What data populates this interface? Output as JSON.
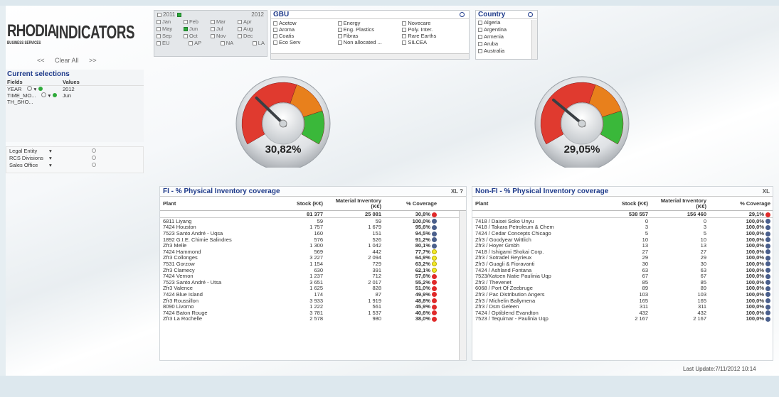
{
  "branding": {
    "company": "RHODIA",
    "subtitle": "BUSINESS SERVICES",
    "title": "INDICATORS"
  },
  "nav": {
    "prev": "<<",
    "clear_all": "Clear All",
    "next": ">>"
  },
  "current_selections": {
    "title": "Current selections",
    "col_fields": "Fields",
    "col_values": "Values",
    "rows": [
      {
        "field": "YEAR",
        "value": "2012"
      },
      {
        "field": "TIME_MO...",
        "value": "Jun"
      },
      {
        "field": "TH_SHO...",
        "value": ""
      }
    ]
  },
  "filters": [
    {
      "label": "Legal Entity"
    },
    {
      "label": "RCS Divisions"
    },
    {
      "label": "Sales Office"
    }
  ],
  "calendar": {
    "year_prev": "2011",
    "year_curr": "2012",
    "months": [
      "Jan",
      "Feb",
      "Mar",
      "Apr",
      "May",
      "Jun",
      "Jul",
      "Aug",
      "Sep",
      "Oct",
      "Nov",
      "Dec"
    ],
    "selected_month": "Jun",
    "regions": [
      "EU",
      "AP",
      "NA",
      "LA"
    ]
  },
  "gbu": {
    "title": "GBU",
    "items": [
      "Acetow",
      "Energy",
      "Novecare",
      "Aroma",
      "Eng. Plastics",
      "Poly. Inter.",
      "Coatis",
      "Fibras",
      "Rare Earths",
      "Eco Serv",
      "Non allocated ...",
      "SILCEA"
    ]
  },
  "country": {
    "title": "Country",
    "items": [
      "Algeria",
      "Argentina",
      "Armenia",
      "Aruba",
      "Australia"
    ]
  },
  "gauges": {
    "left": {
      "value": "30,82%",
      "needle_pct": 30.82
    },
    "right": {
      "value": "29,05%",
      "needle_pct": 29.05
    },
    "colors": {
      "red": "#e03a2f",
      "orange": "#e8801c",
      "green": "#3ab83a"
    }
  },
  "fi_table": {
    "title": "FI - % Physical Inventory coverage",
    "tools": "XL ?",
    "col_plant": "Plant",
    "col_stock": "Stock (K€)",
    "col_material": "Material Inventory (K€)",
    "col_cov": "% Coverage",
    "totals": {
      "stock": "81 377",
      "material": "25 081",
      "cov": "30,8%",
      "status": "red"
    },
    "rows": [
      {
        "plant": "6811 Liyang",
        "stock": "59",
        "material": "59",
        "cov": "100,0%",
        "status": "blue"
      },
      {
        "plant": "7424 Houston",
        "stock": "1 757",
        "material": "1 679",
        "cov": "95,6%",
        "status": "blue"
      },
      {
        "plant": "7523 Santo André - Uqsa",
        "stock": "160",
        "material": "151",
        "cov": "94,5%",
        "status": "blue"
      },
      {
        "plant": "1892 G.I.E. Chimie Salindres",
        "stock": "576",
        "material": "526",
        "cov": "91,2%",
        "status": "blue"
      },
      {
        "plant": "Zfr3 Melle",
        "stock": "1 300",
        "material": "1 042",
        "cov": "80,1%",
        "status": "blue"
      },
      {
        "plant": "7424 Hammond",
        "stock": "569",
        "material": "442",
        "cov": "77,7%",
        "status": "yellow"
      },
      {
        "plant": "Zfr3 Collonges",
        "stock": "3 227",
        "material": "2 094",
        "cov": "64,9%",
        "status": "yellow"
      },
      {
        "plant": "7531 Gorzow",
        "stock": "1 154",
        "material": "729",
        "cov": "63,2%",
        "status": "yellow"
      },
      {
        "plant": "Zfr3 Clamecy",
        "stock": "630",
        "material": "391",
        "cov": "62,1%",
        "status": "yellow"
      },
      {
        "plant": "7424 Vernon",
        "stock": "1 237",
        "material": "712",
        "cov": "57,6%",
        "status": "red"
      },
      {
        "plant": "7523 Santo André - Utsa",
        "stock": "3 651",
        "material": "2 017",
        "cov": "55,2%",
        "status": "red"
      },
      {
        "plant": "Zfr3 Valence",
        "stock": "1 625",
        "material": "828",
        "cov": "51,0%",
        "status": "red"
      },
      {
        "plant": "7424 Blue Island",
        "stock": "174",
        "material": "87",
        "cov": "49,9%",
        "status": "red"
      },
      {
        "plant": "Zfr3 Roussillon",
        "stock": "3 933",
        "material": "1 919",
        "cov": "48,8%",
        "status": "red"
      },
      {
        "plant": "8090 Livorno",
        "stock": "1 222",
        "material": "561",
        "cov": "45,9%",
        "status": "red"
      },
      {
        "plant": "7424 Baton Rouge",
        "stock": "3 781",
        "material": "1 537",
        "cov": "40,6%",
        "status": "red"
      },
      {
        "plant": "Zfr3 La Rochelle",
        "stock": "2 578",
        "material": "980",
        "cov": "38,0%",
        "status": "red"
      }
    ]
  },
  "nonfi_table": {
    "title": "Non-FI - % Physical Inventory coverage",
    "tools": "XL",
    "col_plant": "Plant",
    "col_stock": "Stock (K€)",
    "col_material": "Material Inventory (K€)",
    "col_cov": "% Coverage",
    "totals": {
      "stock": "538 557",
      "material": "156 460",
      "cov": "29,1%",
      "status": "red"
    },
    "rows": [
      {
        "plant": "7418 / Daisei Soko Unyu",
        "stock": "0",
        "material": "0",
        "cov": "100,0%",
        "status": "blue"
      },
      {
        "plant": "7418 / Takara Petroleum & Chem",
        "stock": "3",
        "material": "3",
        "cov": "100,0%",
        "status": "blue"
      },
      {
        "plant": "7424 / Cedar Concepts Chicago",
        "stock": "5",
        "material": "5",
        "cov": "100,0%",
        "status": "blue"
      },
      {
        "plant": "Zfr3 / Goodyear Wittlich",
        "stock": "10",
        "material": "10",
        "cov": "100,0%",
        "status": "blue"
      },
      {
        "plant": "Zfr3 / Hoyer Gmbh",
        "stock": "13",
        "material": "13",
        "cov": "100,0%",
        "status": "blue"
      },
      {
        "plant": "7418 / Ishigami Shokai Corp.",
        "stock": "27",
        "material": "27",
        "cov": "100,0%",
        "status": "blue"
      },
      {
        "plant": "Zfr3 / Sotradel Reyrieux",
        "stock": "29",
        "material": "29",
        "cov": "100,0%",
        "status": "blue"
      },
      {
        "plant": "Zfr3 / Guagli & Fioravanti",
        "stock": "30",
        "material": "30",
        "cov": "100,0%",
        "status": "blue"
      },
      {
        "plant": "7424 / Ashland Fontana",
        "stock": "63",
        "material": "63",
        "cov": "100,0%",
        "status": "blue"
      },
      {
        "plant": "7523/Katoen Natie Paulinia Uqp",
        "stock": "67",
        "material": "67",
        "cov": "100,0%",
        "status": "blue"
      },
      {
        "plant": "Zfr3 / Thevenet",
        "stock": "85",
        "material": "85",
        "cov": "100,0%",
        "status": "blue"
      },
      {
        "plant": "6068 / Port Of Zeebruge",
        "stock": "89",
        "material": "89",
        "cov": "100,0%",
        "status": "blue"
      },
      {
        "plant": "Zfr3 / Pac Distribution Angers",
        "stock": "103",
        "material": "103",
        "cov": "100,0%",
        "status": "blue"
      },
      {
        "plant": "Zfr3 / Michelin Ballymena",
        "stock": "165",
        "material": "165",
        "cov": "100,0%",
        "status": "blue"
      },
      {
        "plant": "Zfr3 / Dsm Geleen",
        "stock": "311",
        "material": "311",
        "cov": "100,0%",
        "status": "blue"
      },
      {
        "plant": "7424 / Optiblend Evandton",
        "stock": "432",
        "material": "432",
        "cov": "100,0%",
        "status": "blue"
      },
      {
        "plant": "7523 / Tequimar - Paulinia Uqp",
        "stock": "2 167",
        "material": "2 167",
        "cov": "100,0%",
        "status": "blue"
      }
    ]
  },
  "status_colors": {
    "blue": "#4a5f8c",
    "yellow": "#f2ea2a",
    "red": "#e02a2a"
  },
  "footer": {
    "last_update": "Last Update:7/11/2012 10:14"
  }
}
